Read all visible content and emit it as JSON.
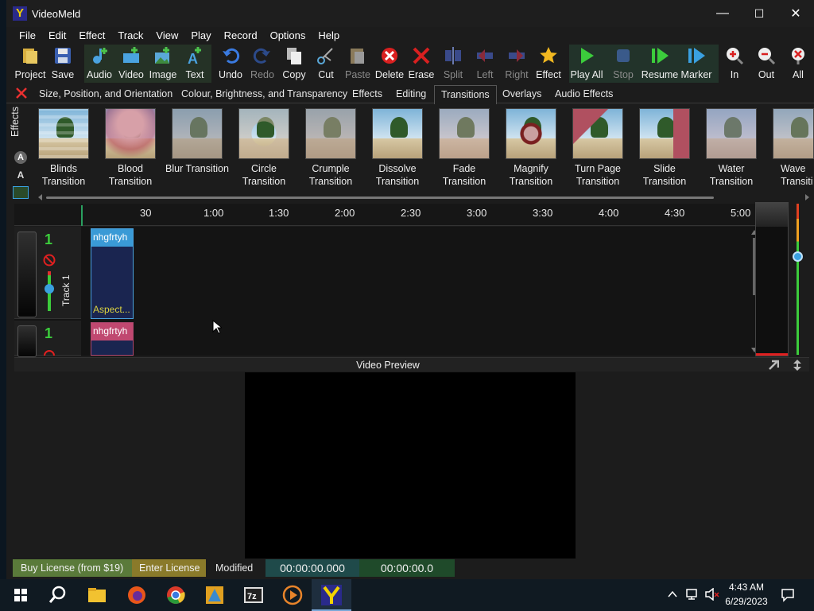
{
  "app": {
    "title": "VideoMeld",
    "logo_letter": "Y"
  },
  "window_controls": {
    "minimize": "—",
    "maximize": "☐",
    "close": "✕"
  },
  "menu": [
    "File",
    "Edit",
    "Effect",
    "Track",
    "View",
    "Play",
    "Record",
    "Options",
    "Help"
  ],
  "toolbar": [
    {
      "label": "Project",
      "icon": "project-icon",
      "enabled": true
    },
    {
      "label": "Save",
      "icon": "save-icon",
      "enabled": true
    },
    {
      "label": "Audio",
      "icon": "audio-add-icon",
      "enabled": true
    },
    {
      "label": "Video",
      "icon": "video-add-icon",
      "enabled": true
    },
    {
      "label": "Image",
      "icon": "image-add-icon",
      "enabled": true
    },
    {
      "label": "Text",
      "icon": "text-add-icon",
      "enabled": true
    },
    {
      "label": "Undo",
      "icon": "undo-icon",
      "enabled": true
    },
    {
      "label": "Redo",
      "icon": "redo-icon",
      "enabled": false
    },
    {
      "label": "Copy",
      "icon": "copy-icon",
      "enabled": true
    },
    {
      "label": "Cut",
      "icon": "cut-icon",
      "enabled": true
    },
    {
      "label": "Paste",
      "icon": "paste-icon",
      "enabled": false
    },
    {
      "label": "Delete",
      "icon": "delete-icon",
      "enabled": true
    },
    {
      "label": "Erase",
      "icon": "erase-icon",
      "enabled": true
    },
    {
      "label": "Split",
      "icon": "split-icon",
      "enabled": false
    },
    {
      "label": "Left",
      "icon": "left-icon",
      "enabled": false
    },
    {
      "label": "Right",
      "icon": "right-icon",
      "enabled": false
    },
    {
      "label": "Effect",
      "icon": "effect-star-icon",
      "enabled": true
    },
    {
      "label": "Play All",
      "icon": "play-icon",
      "enabled": true
    },
    {
      "label": "Stop",
      "icon": "stop-icon",
      "enabled": false
    },
    {
      "label": "Resume",
      "icon": "resume-icon",
      "enabled": true
    },
    {
      "label": "Marker",
      "icon": "marker-icon",
      "enabled": true
    },
    {
      "label": "In",
      "icon": "zoom-in-icon",
      "enabled": true
    },
    {
      "label": "Out",
      "icon": "zoom-out-icon",
      "enabled": true
    },
    {
      "label": "All",
      "icon": "zoom-all-icon",
      "enabled": true
    }
  ],
  "effect_tabs": [
    {
      "label": "Size, Position, and Orientation",
      "active": false
    },
    {
      "label": "Colour, Brightness, and Transparency",
      "active": false
    },
    {
      "label": "Effects",
      "active": false
    },
    {
      "label": "Editing",
      "active": false
    },
    {
      "label": "Transitions",
      "active": true
    },
    {
      "label": "Overlays",
      "active": false
    },
    {
      "label": "Audio Effects",
      "active": false
    }
  ],
  "effects_side_label": "Effects",
  "transitions": [
    {
      "line1": "Blinds",
      "line2": "Transition"
    },
    {
      "line1": "Blood",
      "line2": "Transition"
    },
    {
      "line1": "Blur Transition",
      "line2": ""
    },
    {
      "line1": "Circle",
      "line2": "Transition"
    },
    {
      "line1": "Crumple",
      "line2": "Transition"
    },
    {
      "line1": "Dissolve",
      "line2": "Transition"
    },
    {
      "line1": "Fade",
      "line2": "Transition"
    },
    {
      "line1": "Magnify",
      "line2": "Transition"
    },
    {
      "line1": "Turn Page",
      "line2": "Transition"
    },
    {
      "line1": "Slide",
      "line2": "Transition"
    },
    {
      "line1": "Water",
      "line2": "Transition"
    },
    {
      "line1": "Wave",
      "line2": "Transiti"
    }
  ],
  "ruler_ticks": [
    "30",
    "1:00",
    "1:30",
    "2:00",
    "2:30",
    "3:00",
    "3:30",
    "4:00",
    "4:30",
    "5:00"
  ],
  "tracks": [
    {
      "number": "1",
      "name": "Track 1",
      "clip_title": "nhgfrtyh",
      "clip_footer": "Aspect..."
    },
    {
      "number": "1",
      "name": "",
      "clip_title": "nhgfrtyh",
      "clip_footer": ""
    }
  ],
  "preview_label": "Video Preview",
  "status": {
    "buy": "Buy License (from $19)",
    "enter": "Enter License",
    "modified": "Modified",
    "time_position": "00:00:00.000",
    "time_total": "00:00:00.0"
  },
  "taskbar": {
    "time": "4:43 AM",
    "date": "6/29/2023"
  },
  "colors": {
    "accent_blue": "#3a9ad6",
    "buy_green": "#5a7a3a",
    "enter_gold": "#8a7a2a",
    "time_teal": "#1f4a4a"
  }
}
